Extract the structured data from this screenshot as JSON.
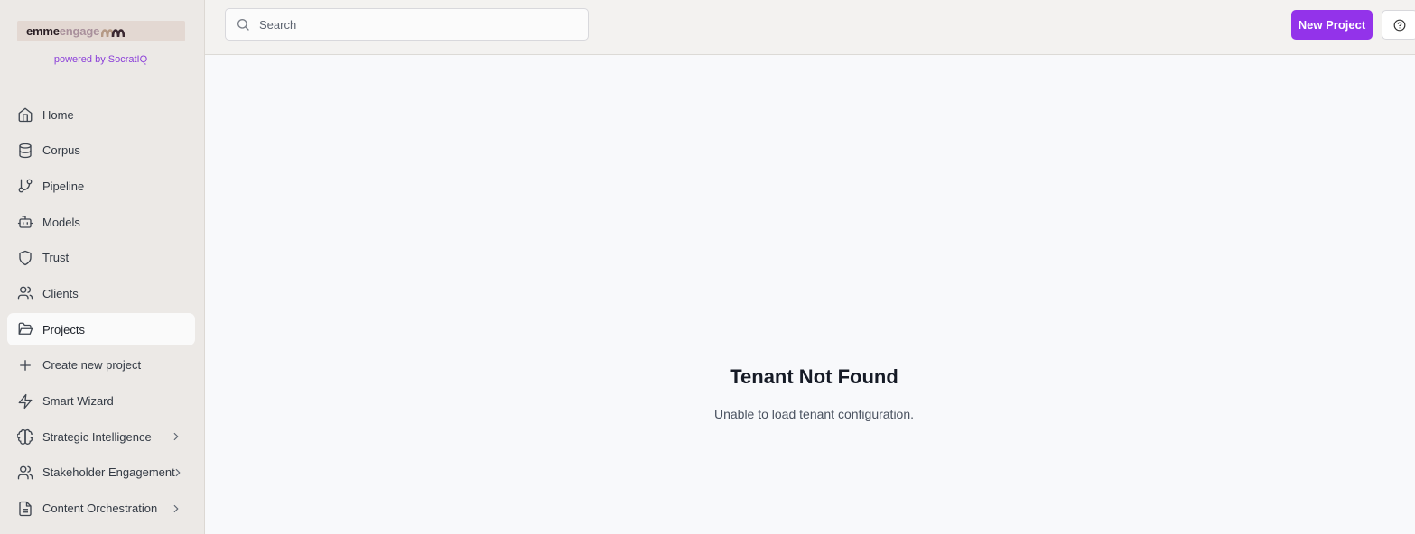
{
  "brand": {
    "logo_word1": "emme",
    "logo_word2": "engage",
    "powered_by": "powered by SocratIQ"
  },
  "sidebar": {
    "items": [
      {
        "label": "Home",
        "icon": "home-icon"
      },
      {
        "label": "Corpus",
        "icon": "database-icon"
      },
      {
        "label": "Pipeline",
        "icon": "git-branch-icon"
      },
      {
        "label": "Models",
        "icon": "bot-icon"
      },
      {
        "label": "Trust",
        "icon": "shield-icon"
      },
      {
        "label": "Clients",
        "icon": "users-icon"
      },
      {
        "label": "Projects",
        "icon": "folder-open-icon",
        "active": true
      },
      {
        "label": "Create new project",
        "icon": "plus-icon"
      },
      {
        "label": "Smart Wizard",
        "icon": "zap-icon"
      },
      {
        "label": "Strategic Intelligence",
        "icon": "brain-icon",
        "expandable": true
      },
      {
        "label": "Stakeholder Engagement",
        "icon": "users-icon",
        "expandable": true
      },
      {
        "label": "Content Orchestration",
        "icon": "file-text-icon",
        "expandable": true
      }
    ]
  },
  "topbar": {
    "search_placeholder": "Search",
    "new_project_label": "New Project",
    "help_icon": "help-circle-icon"
  },
  "main": {
    "title": "Tenant Not Found",
    "message": "Unable to load tenant configuration."
  },
  "colors": {
    "accent": "#9333ea",
    "sidebar_bg": "#ece9e6",
    "main_bg": "#f8f9fb"
  }
}
